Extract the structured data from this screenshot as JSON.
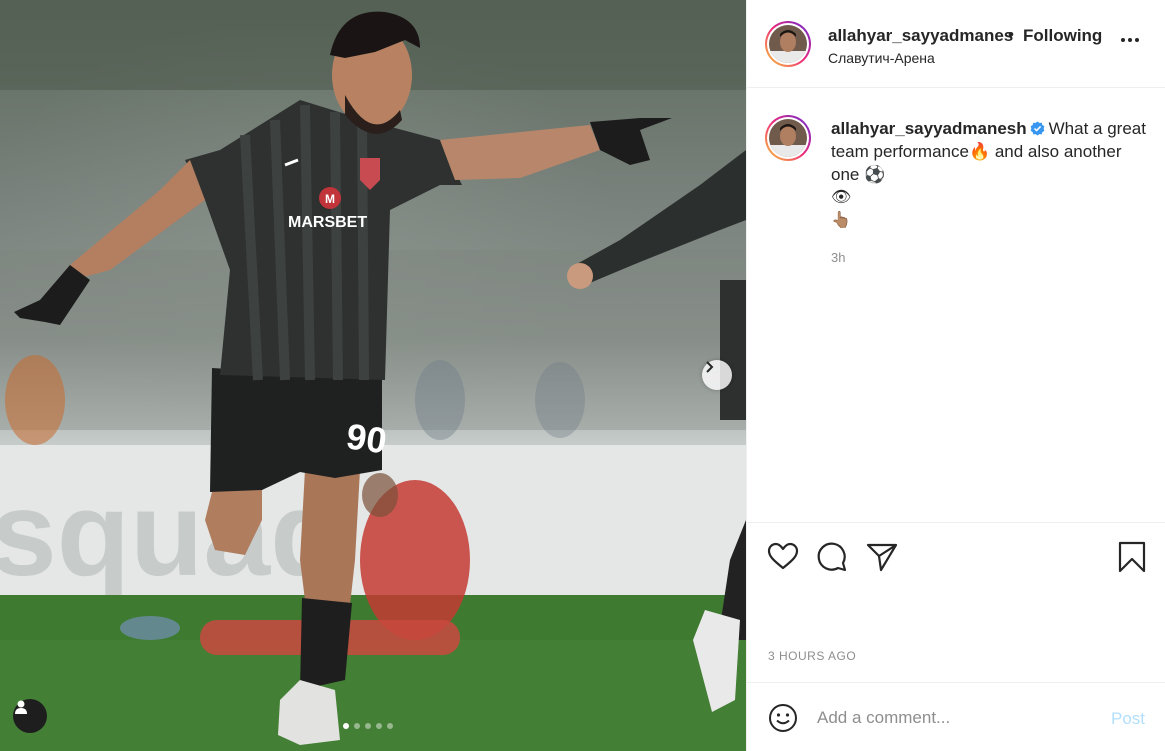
{
  "post": {
    "slides": {
      "count": 5,
      "active_index": 0
    },
    "jersey_sponsor": "MARSBET",
    "jersey_number": "90",
    "sponsor_badge": "M",
    "board_text": "squad"
  },
  "header": {
    "username": "allahyar_sayyadmanes",
    "separator": "•",
    "follow_label": "Following",
    "location": "Славутич-Арена"
  },
  "caption": {
    "username": "allahyar_sayyadmanesh",
    "verified": true,
    "text_1": "What a great team performance",
    "emoji_fire": "🔥",
    "text_2": " and also another one ",
    "emoji_ball": "⚽",
    "emoji_eye": "👁",
    "emoji_point": "👆🏽",
    "time": "3h"
  },
  "actions": {
    "icons": [
      "heart-icon",
      "comment-icon",
      "share-icon",
      "bookmark-icon"
    ],
    "timestamp": "3 HOURS AGO"
  },
  "comment_box": {
    "placeholder": "Add a comment...",
    "post_label": "Post"
  },
  "colors": {
    "post_button_disabled": "#b2dffc",
    "verified_blue": "#3897f0",
    "muted_text": "#8e8e8e"
  }
}
